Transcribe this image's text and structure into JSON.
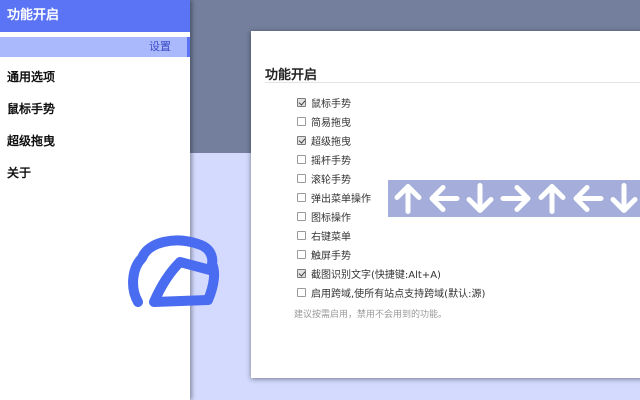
{
  "sidebar": {
    "title": "功能开启",
    "settings_label": "设置",
    "items": [
      {
        "label": "通用选项"
      },
      {
        "label": "鼠标手势"
      },
      {
        "label": "超级拖曳"
      },
      {
        "label": "关于"
      }
    ]
  },
  "main": {
    "title": "功能开启",
    "options": [
      {
        "label": "鼠标手势",
        "checked": true
      },
      {
        "label": "简易拖曳",
        "checked": false
      },
      {
        "label": "超级拖曳",
        "checked": true
      },
      {
        "label": "摇杆手势",
        "checked": false
      },
      {
        "label": "滚轮手势",
        "checked": false
      },
      {
        "label": "弹出菜单操作",
        "checked": false
      },
      {
        "label": "图标操作",
        "checked": false
      },
      {
        "label": "右键菜单",
        "checked": false
      },
      {
        "label": "触屏手势",
        "checked": false
      },
      {
        "label": "截图识别文字(快捷键:Alt+A)",
        "checked": true
      },
      {
        "label": "启用跨域,使所有站点支持跨域(默认:源)",
        "checked": false
      }
    ],
    "hint": "建议按需启用，禁用不会用到的功能。"
  },
  "gesture_overlay": {
    "arrows": [
      "up",
      "left",
      "down",
      "right",
      "up",
      "left",
      "down"
    ],
    "colors": {
      "bar": "#a5adda",
      "arrow": "#ffffff",
      "stroke": "#4a6cf0"
    }
  },
  "colors": {
    "sidebar_header": "#5b73f5",
    "settings_highlight": "#aab9fc",
    "background": "#d3dafe",
    "top_band": "#737f9c"
  }
}
